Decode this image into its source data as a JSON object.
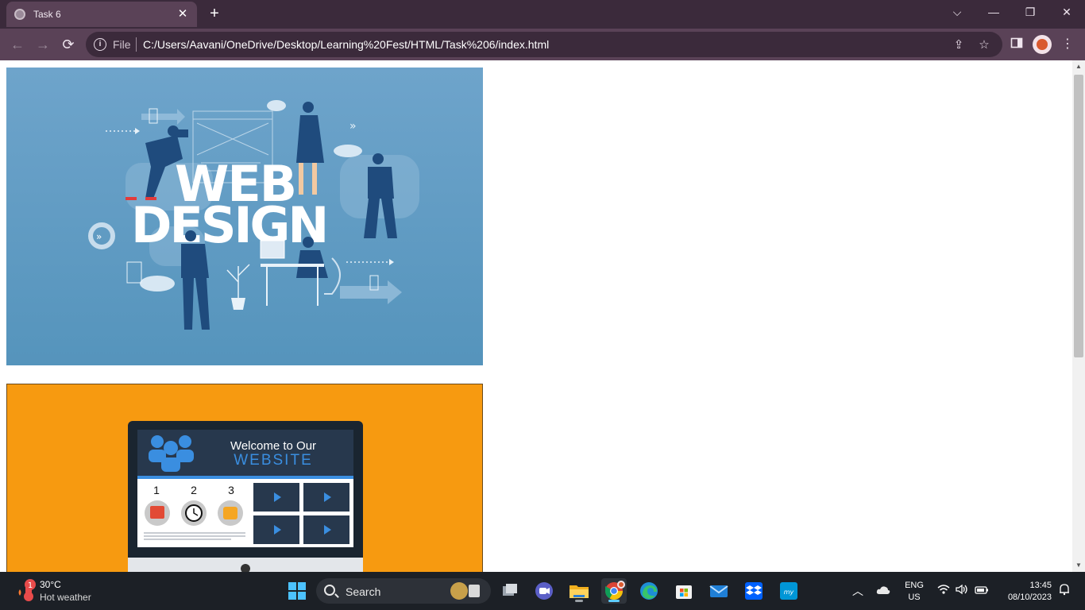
{
  "browser": {
    "tab": {
      "title": "Task 6",
      "close": "✕"
    },
    "new_tab": "+",
    "window_controls": {
      "tab_search": "⌵",
      "minimize": "—",
      "restore": "❐",
      "close": "✕"
    },
    "nav": {
      "back": "←",
      "forward": "→",
      "reload": "⟳"
    },
    "omnibox": {
      "scheme_label": "File",
      "url": "C:/Users/Aavani/OneDrive/Desktop/Learning%20Fest/HTML/Task%206/index.html"
    },
    "menu": "⋮"
  },
  "page": {
    "image1": {
      "title_line1": "WEB",
      "title_line2": "DESIGN",
      "bg_color": "#6aa1c8"
    },
    "image2": {
      "bg_color": "#f79a10",
      "welcome": "Welcome to Our",
      "website": "WEBSITE",
      "steps": [
        "1",
        "2",
        "3"
      ]
    }
  },
  "taskbar": {
    "weather": {
      "temp": "30°C",
      "desc": "Hot weather",
      "badge": "1"
    },
    "search_label": "Search",
    "tray": {
      "lang_line1": "ENG",
      "lang_line2": "US",
      "time": "13:45",
      "date": "08/10/2023"
    }
  },
  "colors": {
    "tab_strip": "#3b2a3b",
    "toolbar": "#5a4257",
    "taskbar": "#1c2026",
    "accent": "#60cdff"
  }
}
